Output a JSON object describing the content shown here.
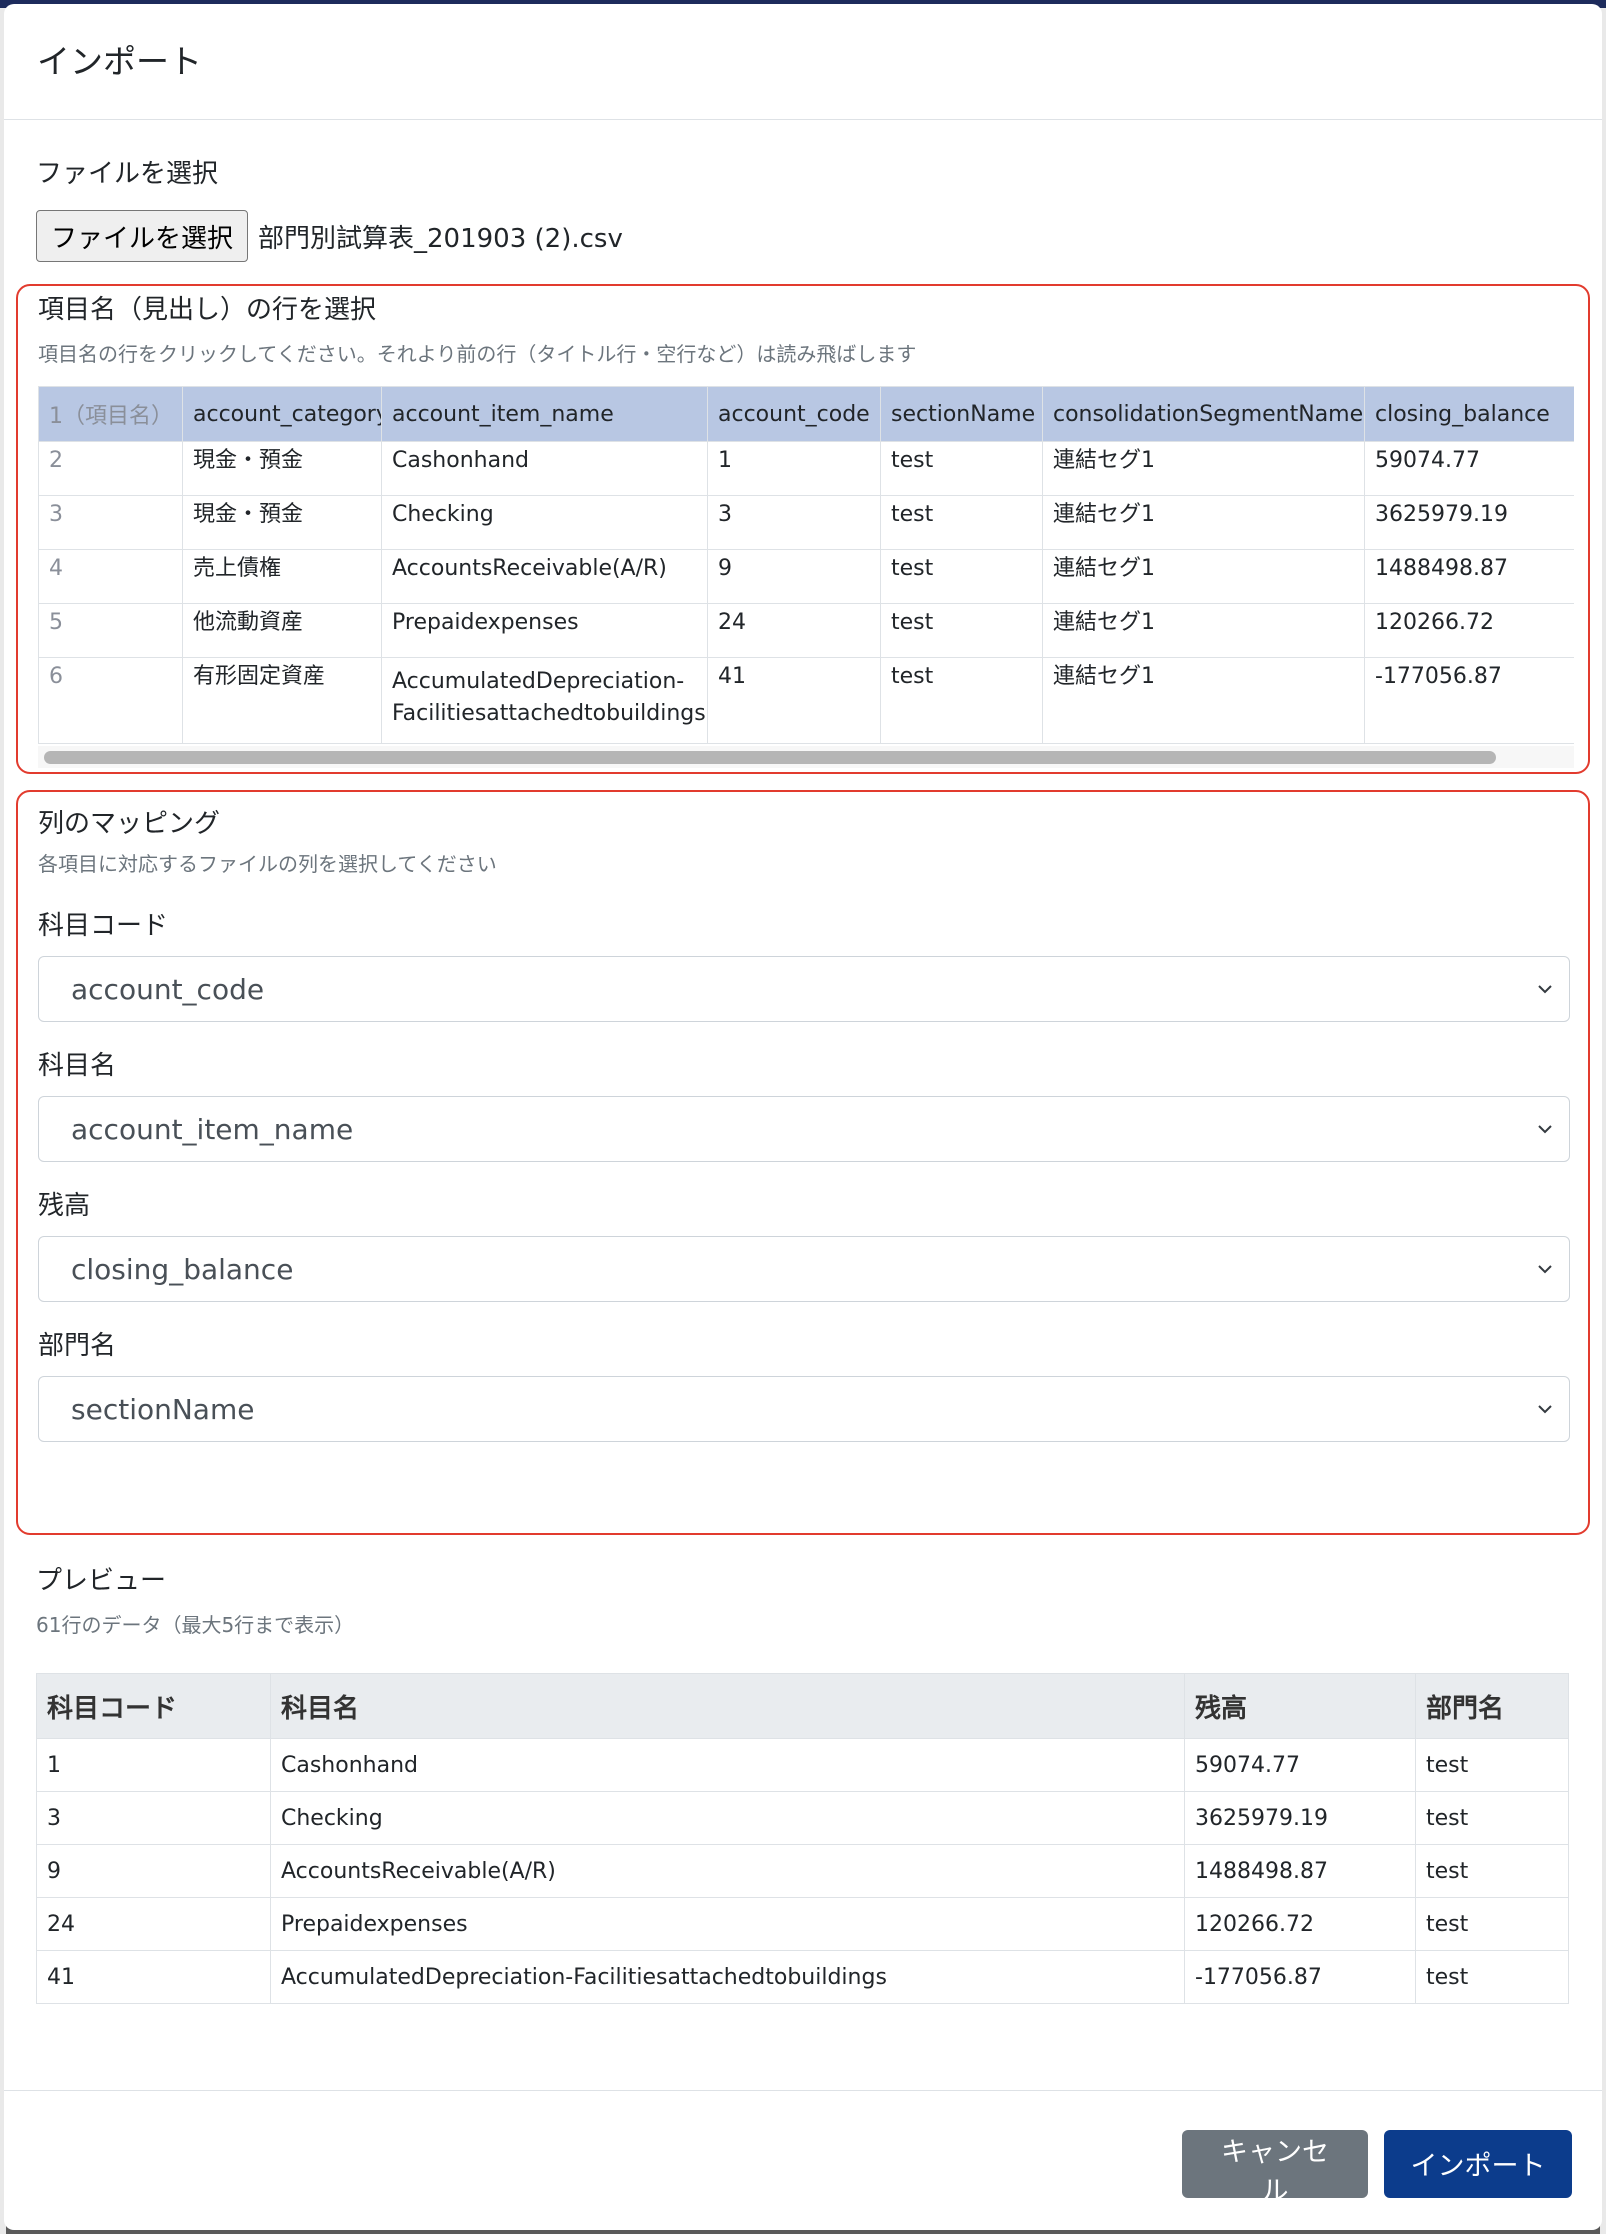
{
  "modal": {
    "title": "インポート"
  },
  "file": {
    "label": "ファイルを選択",
    "button_label": "ファイルを選択",
    "selected_file": "部門別試算表_201903 (2).csv"
  },
  "header_row": {
    "title": "項目名（見出し）の行を選択",
    "description": "項目名の行をクリックしてください。それより前の行（タイトル行・空行など）は読み飛ばします",
    "columns": [
      "1（項目名）",
      "account_category_name",
      "account_item_name",
      "account_code",
      "sectionName",
      "consolidationSegmentName",
      "closing_balance"
    ],
    "rows": [
      [
        "2",
        "現金・預金",
        "Cashonhand",
        "1",
        "test",
        "連結セグ1",
        "59074.77"
      ],
      [
        "3",
        "現金・預金",
        "Checking",
        "3",
        "test",
        "連結セグ1",
        "3625979.19"
      ],
      [
        "4",
        "売上債権",
        "AccountsReceivable(A/R)",
        "9",
        "test",
        "連結セグ1",
        "1488498.87"
      ],
      [
        "5",
        "他流動資産",
        "Prepaidexpenses",
        "24",
        "test",
        "連結セグ1",
        "120266.72"
      ],
      [
        "6",
        "有形固定資産",
        "AccumulatedDepreciation-Facilitiesattachedtobuildings",
        "41",
        "test",
        "連結セグ1",
        "-177056.87"
      ]
    ]
  },
  "mapping": {
    "title": "列のマッピング",
    "description": "各項目に対応するファイルの列を選択してください",
    "fields": [
      {
        "label": "科目コード",
        "value": "account_code"
      },
      {
        "label": "科目名",
        "value": "account_item_name"
      },
      {
        "label": "残高",
        "value": "closing_balance"
      },
      {
        "label": "部門名",
        "value": "sectionName"
      }
    ]
  },
  "preview": {
    "title": "プレビュー",
    "summary": "61行のデータ（最大5行まで表示）",
    "columns": [
      "科目コード",
      "科目名",
      "残高",
      "部門名"
    ],
    "rows": [
      [
        "1",
        "Cashonhand",
        "59074.77",
        "test"
      ],
      [
        "3",
        "Checking",
        "3625979.19",
        "test"
      ],
      [
        "9",
        "AccountsReceivable(A/R)",
        "1488498.87",
        "test"
      ],
      [
        "24",
        "Prepaidexpenses",
        "120266.72",
        "test"
      ],
      [
        "41",
        "AccumulatedDepreciation-Facilitiesattachedtobuildings",
        "-177056.87",
        "test"
      ]
    ]
  },
  "footer": {
    "cancel_label": "キャンセル",
    "import_label": "インポート"
  },
  "colors": {
    "highlight_border": "#e23b2e",
    "header_row_bg": "#b8c7e3",
    "primary": "#0c3c8c",
    "secondary": "#6c757d"
  }
}
